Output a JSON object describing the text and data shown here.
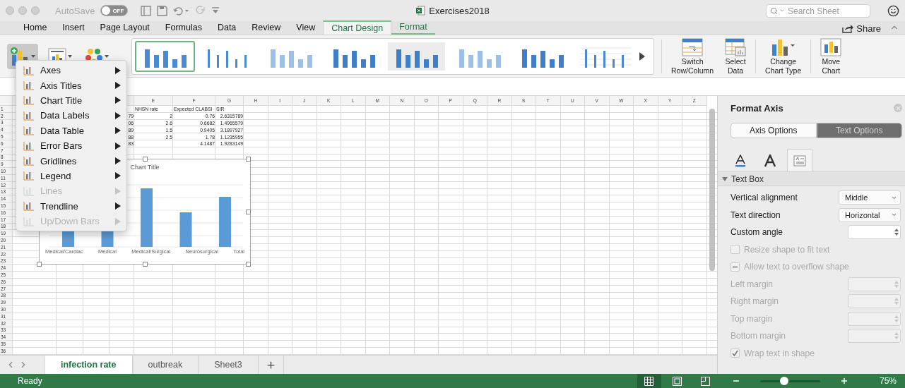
{
  "window": {
    "title": "Exercises2018"
  },
  "autosave": {
    "label": "AutoSave",
    "on": false,
    "state_text": "OFF"
  },
  "search": {
    "placeholder": "Search Sheet"
  },
  "menu_tabs": [
    {
      "label": "Home",
      "selected": false,
      "contextual": false
    },
    {
      "label": "Insert",
      "selected": false,
      "contextual": false
    },
    {
      "label": "Page Layout",
      "selected": false,
      "contextual": false
    },
    {
      "label": "Formulas",
      "selected": false,
      "contextual": false
    },
    {
      "label": "Data",
      "selected": false,
      "contextual": false
    },
    {
      "label": "Review",
      "selected": false,
      "contextual": false
    },
    {
      "label": "View",
      "selected": false,
      "contextual": false
    },
    {
      "label": "Chart Design",
      "selected": true,
      "contextual": true
    },
    {
      "label": "Format",
      "selected": false,
      "contextual": true
    }
  ],
  "share": {
    "label": "Share"
  },
  "ribbon": {
    "add_element_open": true,
    "chart_styles": [
      {
        "selected": true
      },
      {
        "selected": false
      },
      {
        "selected": false
      },
      {
        "selected": false
      },
      {
        "selected": false
      },
      {
        "selected": false
      },
      {
        "selected": false
      },
      {
        "selected": false
      }
    ],
    "buttons": [
      {
        "kind": "switch",
        "lines": [
          "Switch",
          "Row/Column"
        ]
      },
      {
        "kind": "select",
        "lines": [
          "Select",
          "Data"
        ]
      },
      {
        "kind": "change",
        "lines": [
          "Change",
          "Chart Type"
        ]
      },
      {
        "kind": "move",
        "lines": [
          "Move",
          "Chart"
        ]
      }
    ]
  },
  "add_element_menu": {
    "items": [
      {
        "label": "Axes",
        "disabled": false
      },
      {
        "label": "Axis Titles",
        "disabled": false
      },
      {
        "label": "Chart Title",
        "disabled": false
      },
      {
        "label": "Data Labels",
        "disabled": false
      },
      {
        "label": "Data Table",
        "disabled": false
      },
      {
        "label": "Error Bars",
        "disabled": false
      },
      {
        "label": "Gridlines",
        "disabled": false
      },
      {
        "label": "Legend",
        "disabled": false
      },
      {
        "label": "Lines",
        "disabled": true
      },
      {
        "label": "Trendline",
        "disabled": false
      },
      {
        "label": "Up/Down Bars",
        "disabled": true
      }
    ]
  },
  "sheet": {
    "columns": [
      "E",
      "F",
      "G",
      "H",
      "I",
      "J",
      "K",
      "L",
      "M",
      "N",
      "O",
      "P",
      "Q",
      "R",
      "S",
      "T",
      "U",
      "V",
      "W",
      "X",
      "Y",
      "Z"
    ],
    "rows": [
      "1",
      "2",
      "3",
      "4",
      "5",
      "6",
      "7",
      "8",
      "9",
      "10",
      "11",
      "12",
      "13",
      "14",
      "15",
      "16",
      "17",
      "18",
      "19",
      "20",
      "21",
      "22",
      "23",
      "24",
      "25",
      "26",
      "27",
      "28",
      "29",
      "30",
      "31",
      "32",
      "33",
      "34",
      "35",
      "36"
    ],
    "header_cells": {
      "e": "NHSN rate",
      "f": "Expected CLABSI",
      "g": "SIR"
    },
    "value_rows": [
      {
        "d": "79",
        "e": "2",
        "f": "0.76",
        "g": "2.6315789"
      },
      {
        "d": "06",
        "e": "2.6",
        "f": "0.6682",
        "g": "1.4965579"
      },
      {
        "d": "89",
        "e": "1.5",
        "f": "0.9405",
        "g": "3.1897927"
      },
      {
        "d": "88",
        "e": "2.5",
        "f": "1.78",
        "g": "1.1235955"
      },
      {
        "d": "83",
        "f": "4.1487",
        "g": "1.9283149"
      }
    ]
  },
  "chart": {
    "title": "Chart Title",
    "categories": [
      "Medical/Cardiac",
      "Medical",
      "Medical/Surgical",
      "Neurosurgical",
      "Total"
    ]
  },
  "format_panel": {
    "title": "Format Axis",
    "segments": [
      {
        "label": "Axis Options",
        "selected": false
      },
      {
        "label": "Text Options",
        "selected": true
      }
    ],
    "icon_tabs": [
      {
        "kind": "fill",
        "selected": false
      },
      {
        "kind": "effects",
        "selected": false
      },
      {
        "kind": "textbox",
        "selected": true
      }
    ],
    "section": {
      "title": "Text Box",
      "expanded": true
    },
    "fields": [
      {
        "kind": "dropdown",
        "label": "Vertical alignment",
        "value": "Middle",
        "disabled": false
      },
      {
        "kind": "dropdown",
        "label": "Text direction",
        "value": "Horizontal",
        "disabled": false
      },
      {
        "kind": "spinner",
        "label": "Custom angle",
        "disabled": false
      },
      {
        "kind": "checkbox",
        "label": "Resize shape to fit text",
        "checked": false,
        "disabled": true
      },
      {
        "kind": "checkbox",
        "label": "Allow text to overflow shape",
        "checked": false,
        "indeterminate": true,
        "disabled": true
      },
      {
        "kind": "spinner",
        "label": "Left margin",
        "disabled": true
      },
      {
        "kind": "spinner",
        "label": "Right margin",
        "disabled": true
      },
      {
        "kind": "spinner",
        "label": "Top margin",
        "disabled": true
      },
      {
        "kind": "spinner",
        "label": "Bottom margin",
        "disabled": true
      },
      {
        "kind": "checkbox",
        "label": "Wrap text in shape",
        "checked": true,
        "disabled": true
      }
    ]
  },
  "sheet_tabs": [
    {
      "label": "infection rate",
      "selected": true
    },
    {
      "label": "outbreak",
      "selected": false
    },
    {
      "label": "Sheet3",
      "selected": false
    }
  ],
  "status_bar": {
    "text": "Ready",
    "views": [
      {
        "kind": "normal",
        "selected": true
      },
      {
        "kind": "page-layout",
        "selected": false
      },
      {
        "kind": "page-break",
        "selected": false
      }
    ],
    "zoom": {
      "level": 0.4,
      "text": "75%"
    }
  }
}
